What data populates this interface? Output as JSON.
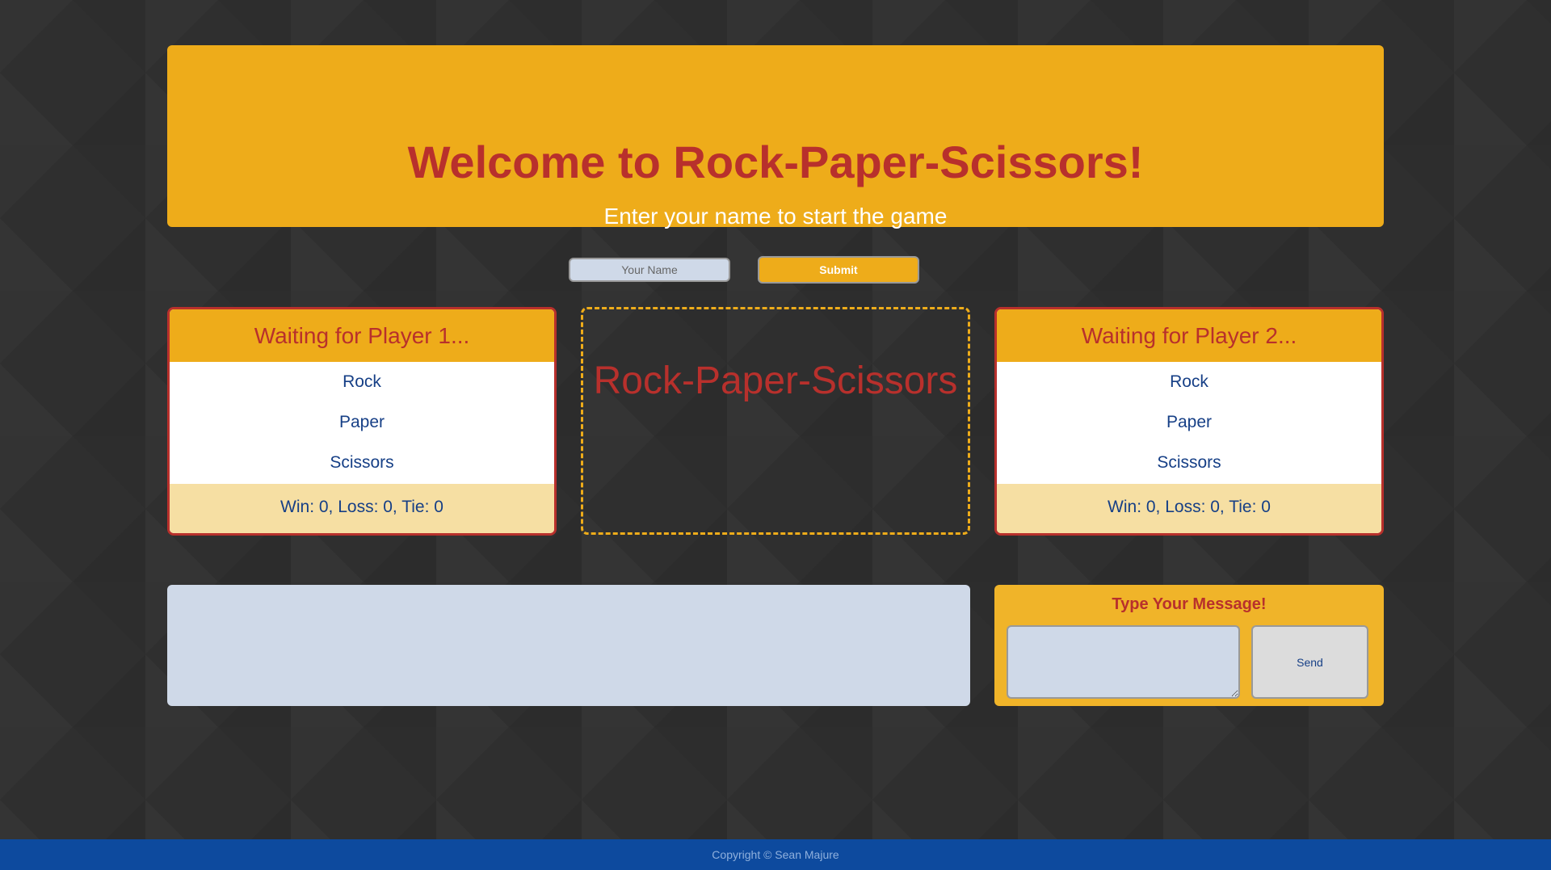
{
  "header": {
    "title": "Welcome to Rock-Paper-Scissors!",
    "subtitle": "Enter your name to start the game"
  },
  "name_form": {
    "placeholder": "Your Name",
    "value": "",
    "submit_label": "Submit"
  },
  "player1": {
    "status": "Waiting for Player 1...",
    "choices": [
      "Rock",
      "Paper",
      "Scissors"
    ],
    "stats": "Win: 0, Loss: 0, Tie: 0"
  },
  "arena": {
    "title": "Rock-Paper-Scissors"
  },
  "player2": {
    "status": "Waiting for Player 2...",
    "choices": [
      "Rock",
      "Paper",
      "Scissors"
    ],
    "stats": "Win: 0, Loss: 0, Tie: 0"
  },
  "chat": {
    "log": "",
    "prompt": "Type Your Message!",
    "message_value": "",
    "send_label": "Send"
  },
  "footer": {
    "copyright": "Copyright © Sean Majure"
  },
  "colors": {
    "background": "#2f2f2f",
    "accent": "#eeac1a",
    "title_red": "#b8302c",
    "text_blue": "#163f86",
    "panel_blue": "#cfd9e8",
    "footer_blue": "#0d4a9e"
  }
}
